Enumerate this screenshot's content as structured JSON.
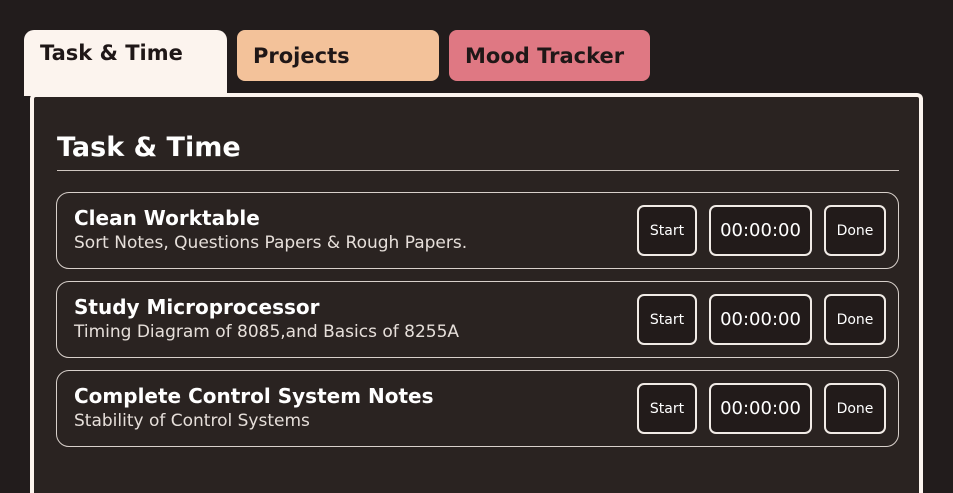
{
  "tabs": [
    {
      "label": "Task & Time",
      "active": true,
      "color": "#fcf4ee"
    },
    {
      "label": "Projects",
      "active": false,
      "color": "#f3c29a"
    },
    {
      "label": "Mood Tracker",
      "active": false,
      "color": "#df7883"
    }
  ],
  "panel": {
    "title": "Task & Time"
  },
  "tasks": [
    {
      "title": "Clean Worktable",
      "description": "Sort Notes, Questions Papers & Rough Papers.",
      "start_label": "Start",
      "timer": "00:00:00",
      "done_label": "Done"
    },
    {
      "title": "Study Microprocessor",
      "description": "Timing Diagram of 8085,and Basics of 8255A",
      "start_label": "Start",
      "timer": "00:00:00",
      "done_label": "Done"
    },
    {
      "title": "Complete Control System Notes",
      "description": "Stability of Control Systems",
      "start_label": "Start",
      "timer": "00:00:00",
      "done_label": "Done"
    }
  ],
  "colors": {
    "background": "#221c1c",
    "panel_background": "#2a2321",
    "panel_border": "#fcf4ee"
  }
}
